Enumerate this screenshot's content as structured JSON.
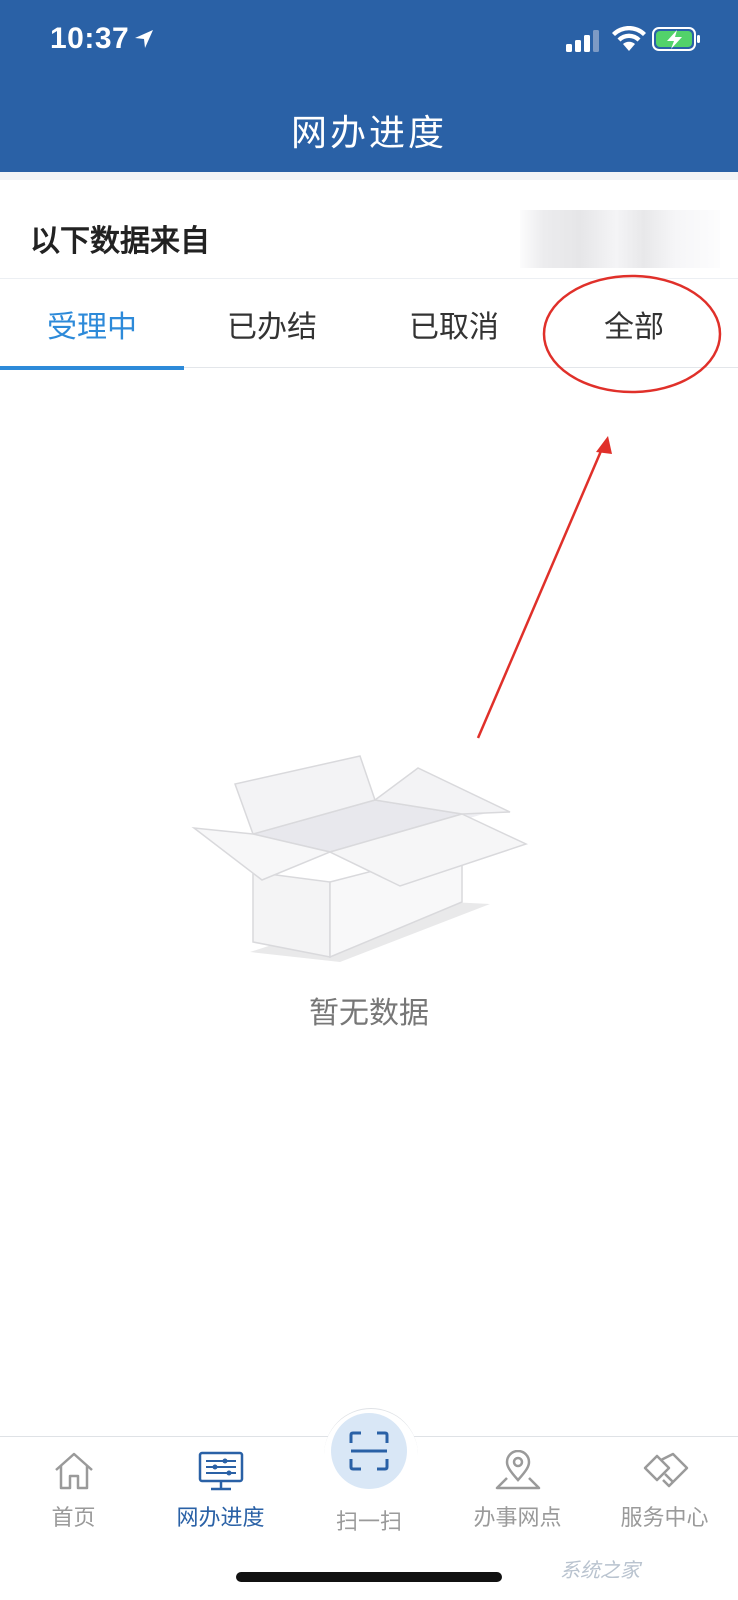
{
  "status_bar": {
    "time": "10:37",
    "icons": [
      "location-arrow-icon",
      "cellular-signal-icon",
      "wifi-icon",
      "battery-charging-icon"
    ]
  },
  "header": {
    "title": "网办进度",
    "background_color": "#2a61a6"
  },
  "source": {
    "label": "以下数据来自"
  },
  "tabs": [
    {
      "label": "受理中",
      "active": true
    },
    {
      "label": "已办结",
      "active": false
    },
    {
      "label": "已取消",
      "active": false
    },
    {
      "label": "全部",
      "active": false
    }
  ],
  "empty_state": {
    "icon": "empty-box-icon",
    "text": "暂无数据"
  },
  "annotation": {
    "target": "全部",
    "color": "#e0302a"
  },
  "bottom_nav": {
    "items": [
      {
        "label": "首页",
        "icon": "home-icon",
        "active": false
      },
      {
        "label": "网办进度",
        "icon": "monitor-icon",
        "active": true
      },
      {
        "label": "扫一扫",
        "icon": "scan-icon",
        "active": false
      },
      {
        "label": "办事网点",
        "icon": "map-pin-icon",
        "active": false
      },
      {
        "label": "服务中心",
        "icon": "service-handshake-icon",
        "active": false
      }
    ]
  },
  "watermark": "系统之家",
  "colors": {
    "accent": "#2d8ad9",
    "header": "#2a61a6",
    "inactive_nav": "#9a9a9a"
  }
}
